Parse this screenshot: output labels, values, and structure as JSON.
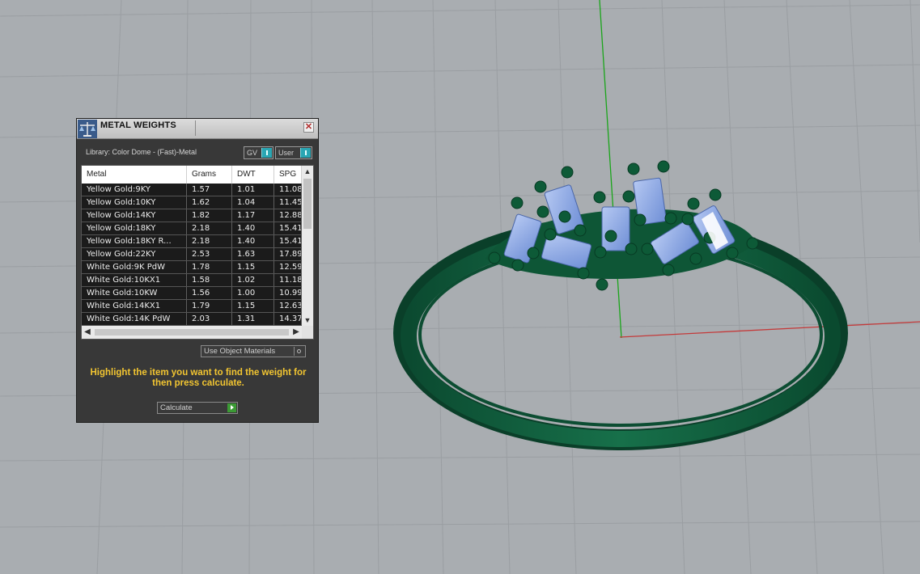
{
  "window": {
    "title": "METAL WEIGHTS",
    "close_label": "✕"
  },
  "library": {
    "label": "Library: Color Dome - (Fast)-Metal",
    "toggle_gv": "GV",
    "toggle_user": "User"
  },
  "table": {
    "columns": [
      "Metal",
      "Grams",
      "DWT",
      "SPG"
    ],
    "rows": [
      [
        "Yellow Gold:9KY",
        "1.57",
        "1.01",
        "11.08"
      ],
      [
        "Yellow Gold:10KY",
        "1.62",
        "1.04",
        "11.45"
      ],
      [
        "Yellow Gold:14KY",
        "1.82",
        "1.17",
        "12.88"
      ],
      [
        "Yellow Gold:18KY",
        "2.18",
        "1.40",
        "15.41"
      ],
      [
        "Yellow Gold:18KY R...",
        "2.18",
        "1.40",
        "15.41"
      ],
      [
        "Yellow Gold:22KY",
        "2.53",
        "1.63",
        "17.89"
      ],
      [
        "White Gold:9K PdW",
        "1.78",
        "1.15",
        "12.59"
      ],
      [
        "White Gold:10KX1",
        "1.58",
        "1.02",
        "11.18"
      ],
      [
        "White Gold:10KW",
        "1.56",
        "1.00",
        "10.99"
      ],
      [
        "White Gold:14KX1",
        "1.79",
        "1.15",
        "12.63"
      ],
      [
        "White Gold:14K PdW",
        "2.03",
        "1.31",
        "14.37"
      ]
    ]
  },
  "use_object_materials": "Use Object Materials",
  "hint": "Highlight the item you want to find the weight for then press calculate.",
  "calculate_label": "Calculate",
  "colors": {
    "panel_bg": "#383838",
    "hint_text": "#f2c531",
    "ring_green": "#0f5a3b",
    "gem_blue": "#8aa8e8",
    "axis_green": "#1aa51a",
    "axis_red": "#c43a3a"
  }
}
